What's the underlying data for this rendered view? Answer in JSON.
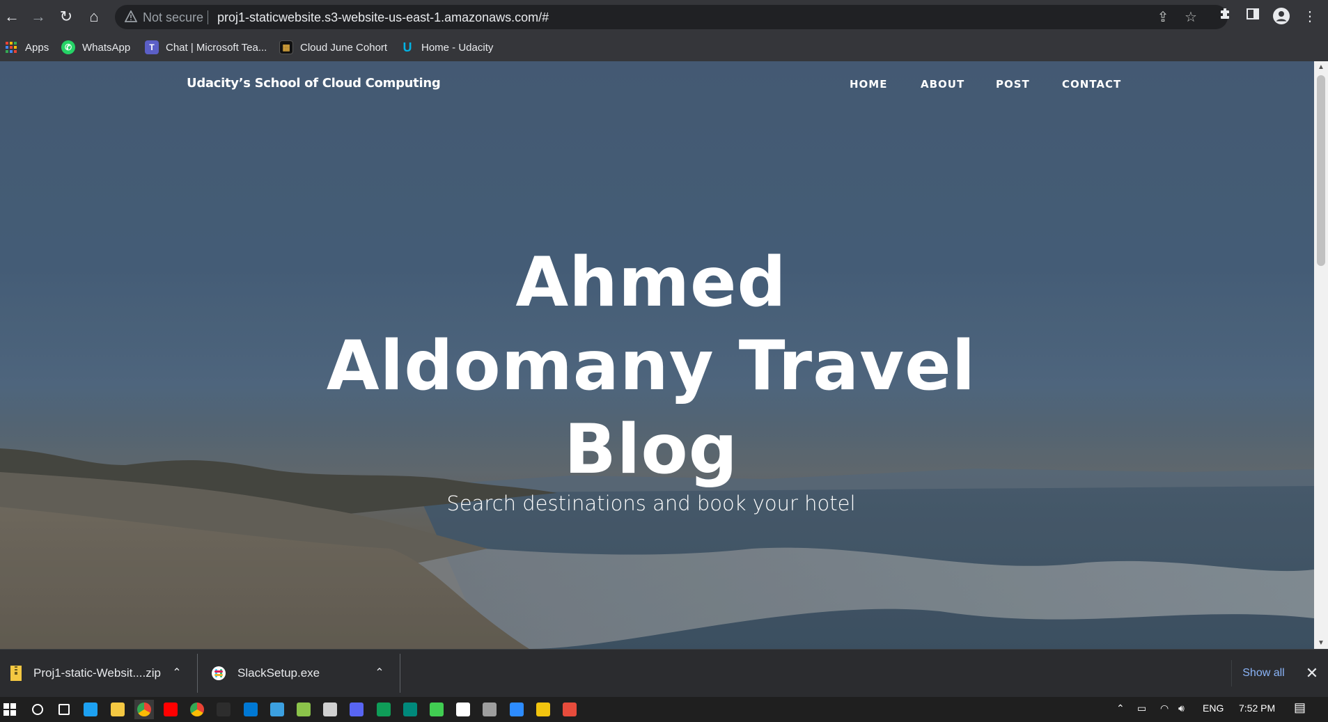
{
  "browser": {
    "nav": {
      "back": "←",
      "forward": "→",
      "reload": "↻",
      "home": "⌂"
    },
    "security_label": "Not secure",
    "url": "proj1-staticwebsite.s3-website-us-east-1.amazonaws.com/#",
    "icons": [
      "share-icon",
      "star-icon",
      "extensions-icon",
      "side-panel-icon",
      "profile-icon",
      "menu-icon"
    ]
  },
  "bookmarks": [
    {
      "label": "Apps",
      "icon": "apps-grid-icon",
      "color": "#ea4335"
    },
    {
      "label": "WhatsApp",
      "icon": "whatsapp-icon",
      "color": "#25d366"
    },
    {
      "label": "Chat | Microsoft Tea...",
      "icon": "teams-icon",
      "color": "#5b5fc7"
    },
    {
      "label": "Cloud June Cohort",
      "icon": "cohort-icon",
      "color": "#444444"
    },
    {
      "label": "Home - Udacity",
      "icon": "udacity-icon",
      "color": "#02b3e4"
    }
  ],
  "site": {
    "brand": "Udacity’s School of Cloud Computing",
    "nav": [
      "HOME",
      "ABOUT",
      "POST",
      "CONTACT"
    ],
    "hero_title_lines": [
      "Ahmed",
      "Aldomany Travel",
      "Blog"
    ],
    "hero_subtitle": "Search destinations and book your hotel"
  },
  "downloads": {
    "items": [
      {
        "name": "Proj1-static-Websit....zip",
        "icon": "zip-file-icon",
        "color": "#f4c842"
      },
      {
        "name": "SlackSetup.exe",
        "icon": "slack-icon",
        "color": "#e01e5a"
      }
    ],
    "show_all": "Show all",
    "close": "✕"
  },
  "taskbar": {
    "language": "ENG",
    "time": "7:52 PM",
    "apps": [
      {
        "name": "search-icon",
        "color": "#ffffff"
      },
      {
        "name": "task-view-icon",
        "color": "#ffffff"
      },
      {
        "name": "edge-icon",
        "color": "#1da1f2"
      },
      {
        "name": "file-explorer-icon",
        "color": "#f4c842"
      },
      {
        "name": "chrome-icon",
        "color": "#ea4335"
      },
      {
        "name": "youtube-icon",
        "color": "#ff0000"
      },
      {
        "name": "chrome-alt-icon",
        "color": "#fbbc05"
      },
      {
        "name": "terminal-icon",
        "color": "#2d2d2d"
      },
      {
        "name": "vscode-icon",
        "color": "#0078d4"
      },
      {
        "name": "app-blue-icon",
        "color": "#3ca0e0"
      },
      {
        "name": "notepad-icon",
        "color": "#8bc34a"
      },
      {
        "name": "photos-icon",
        "color": "#d0d0d0"
      },
      {
        "name": "discord-icon",
        "color": "#5865f2"
      },
      {
        "name": "messages-icon",
        "color": "#0f9d58"
      },
      {
        "name": "meet-icon",
        "color": "#00897b"
      },
      {
        "name": "qt-icon",
        "color": "#41cd52"
      },
      {
        "name": "vpn-icon",
        "color": "#ffffff"
      },
      {
        "name": "headset-icon",
        "color": "#9e9e9e"
      },
      {
        "name": "zoom-icon",
        "color": "#2d8cff"
      },
      {
        "name": "git-icon",
        "color": "#f1c40f"
      },
      {
        "name": "person-app-icon",
        "color": "#e74c3c"
      }
    ]
  }
}
